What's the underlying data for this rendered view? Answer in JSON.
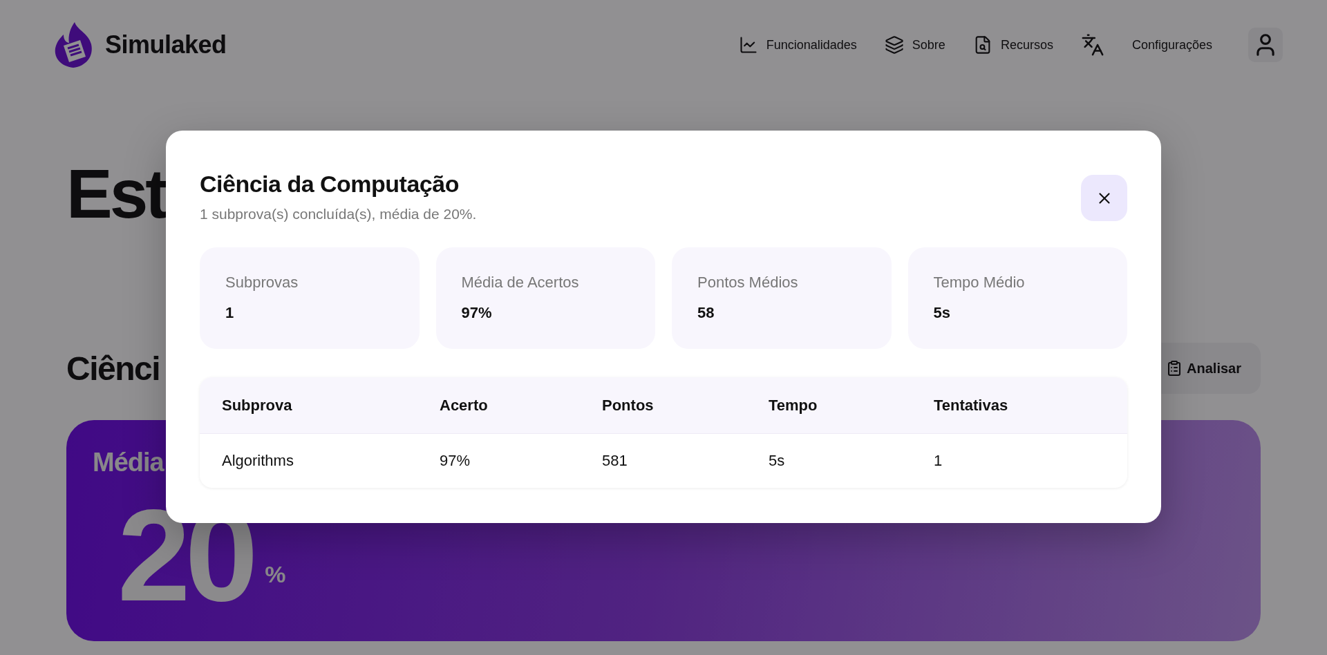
{
  "header": {
    "brand": "Simulaked",
    "nav": [
      {
        "kind": "link",
        "label": "Funcionalidades"
      },
      {
        "kind": "link",
        "label": "Sobre"
      },
      {
        "kind": "link",
        "label": "Recursos"
      },
      {
        "kind": "icon"
      },
      {
        "kind": "link",
        "label": "Configurações"
      }
    ]
  },
  "page": {
    "title": "Est",
    "section_title": "Ciênci",
    "analyze_button": "Analisar",
    "card_label": "Média",
    "card_value": "20",
    "card_unit": "%"
  },
  "modal": {
    "title": "Ciência da Computação",
    "subtitle": "1 subprova(s) concluída(s), média de 20%.",
    "stats": [
      {
        "label": "Subprovas",
        "value": "1"
      },
      {
        "label": "Média de Acertos",
        "value": "97%"
      },
      {
        "label": "Pontos Médios",
        "value": "58"
      },
      {
        "label": "Tempo Médio",
        "value": "5s"
      }
    ],
    "table": {
      "columns": [
        "Subprova",
        "Acerto",
        "Pontos",
        "Tempo",
        "Tentativas"
      ],
      "rows": [
        [
          "Algorithms",
          "97%",
          "581",
          "5s",
          "1"
        ]
      ]
    }
  }
}
